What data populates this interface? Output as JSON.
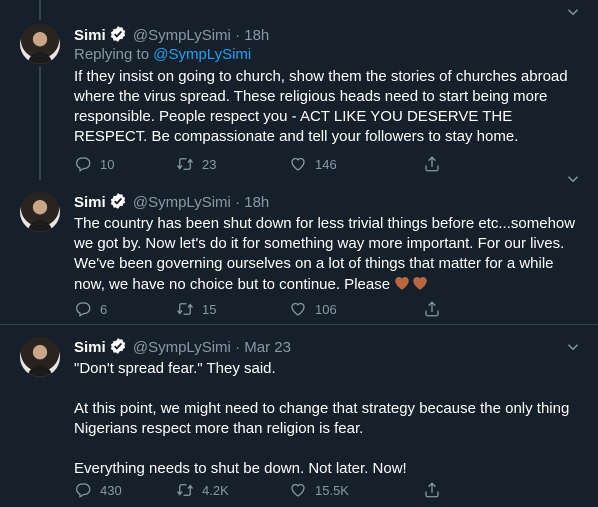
{
  "tweets": [
    {
      "name": "Simi",
      "handle": "@SympLySimi",
      "dot": "·",
      "time": "18h",
      "replying_prefix": "Replying to ",
      "replying_to": "@SympLySimi",
      "text": "If they insist on going to church, show them the stories of churches abroad where the virus spread. These religious heads need to start being more responsible. People respect you - ACT LIKE YOU DESERVE THE RESPECT. Be compassionate and tell your followers to stay home.",
      "replies": "10",
      "retweets": "23",
      "likes": "146"
    },
    {
      "name": "Simi",
      "handle": "@SympLySimi",
      "dot": "·",
      "time": "18h",
      "text": "The country has been shut down for less trivial things before etc...somehow we got by. Now let's do it for something way more important. For our lives. We've been governing ourselves on a lot of things that matter for a while now, we have no choice but to continue. Please",
      "emoji": "brown-heart-icon x2",
      "replies": "6",
      "retweets": "15",
      "likes": "106"
    },
    {
      "name": "Simi",
      "handle": "@SympLySimi",
      "dot": "·",
      "time": "Mar 23",
      "paragraphs": [
        "\"Don't spread fear.\" They said.",
        "At this point, we might need to change that strategy because the only thing Nigerians respect more than religion is fear.",
        "Everything needs to shut be down. Not later. Now!"
      ],
      "replies": "430",
      "retweets": "4.2K",
      "likes": "15.5K"
    }
  ],
  "icons": [
    "verified-badge-icon",
    "chevron-down-icon",
    "reply-icon",
    "retweet-icon",
    "like-icon",
    "share-icon"
  ],
  "colors": {
    "background": "#15202b",
    "text": "#ffffff",
    "secondary": "#8899a6",
    "link": "#1da1f2",
    "divider": "#38444d",
    "heart_emoji": "#b9673f"
  }
}
